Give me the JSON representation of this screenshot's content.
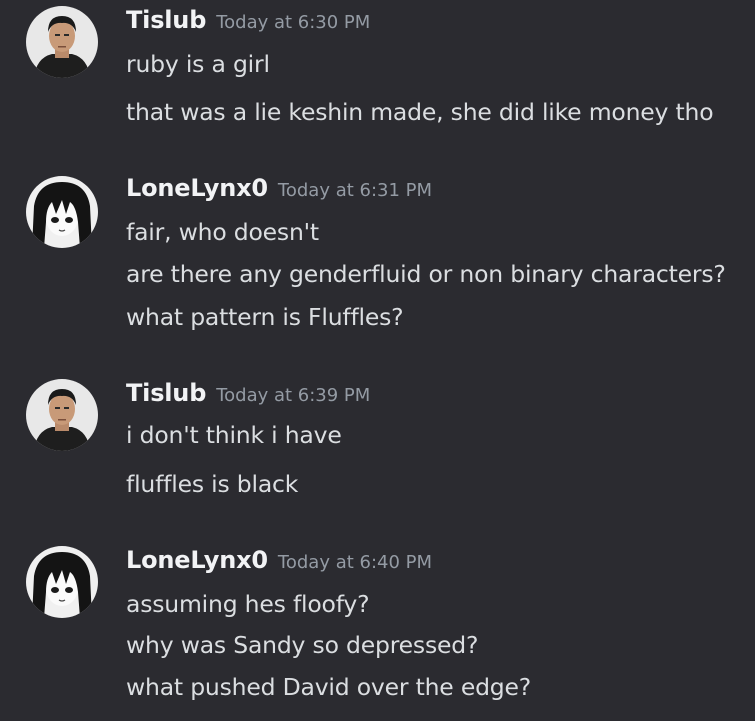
{
  "messages": [
    {
      "author": "Tislub",
      "timestamp": "Today at 6:30 PM",
      "avatar_icon": "man-portrait-avatar",
      "lines": [
        "ruby is a girl",
        "that was a lie keshin made, she did like money tho"
      ]
    },
    {
      "author": "LoneLynx0",
      "timestamp": "Today at 6:31 PM",
      "avatar_icon": "anime-dark-hair-avatar",
      "lines": [
        "fair, who doesn't",
        "are there any genderfluid or non binary characters?",
        "what pattern is Fluffles?"
      ]
    },
    {
      "author": "Tislub",
      "timestamp": "Today at 6:39 PM",
      "avatar_icon": "man-portrait-avatar",
      "lines": [
        "i don't think i have",
        "fluffles is black"
      ]
    },
    {
      "author": "LoneLynx0",
      "timestamp": "Today at 6:40 PM",
      "avatar_icon": "anime-dark-hair-avatar",
      "lines": [
        "assuming hes floofy?",
        "why was Sandy so depressed?",
        "what pushed David over the edge?"
      ]
    }
  ],
  "colors": {
    "background": "#2b2b30",
    "username": "#f2f3f5",
    "timestamp": "#949ba4",
    "message_text": "#dbdee1"
  }
}
